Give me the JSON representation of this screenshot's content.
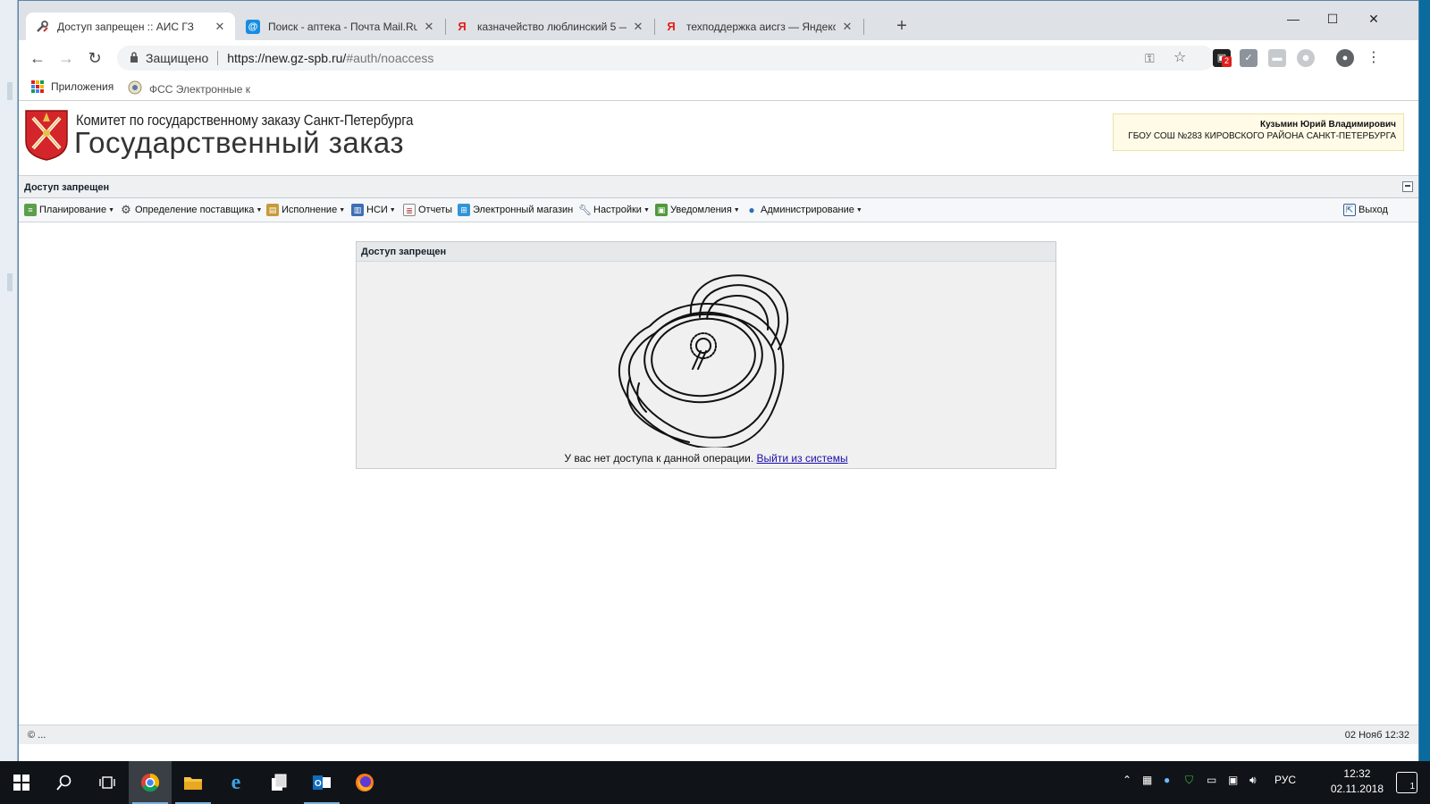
{
  "browser": {
    "tabs": [
      {
        "title": "Доступ запрещен :: АИС ГЗ",
        "active": true,
        "favicon": "tools-icon"
      },
      {
        "title": "Поиск - аптека - Почта Mail.Ru",
        "active": false,
        "favicon": "mail-at-icon"
      },
      {
        "title": "казначейство люблинский 5 —",
        "active": false,
        "favicon": "yandex-icon"
      },
      {
        "title": "техподдержка аисгз — Яндекс",
        "active": false,
        "favicon": "yandex-icon"
      }
    ],
    "new_tab": "+",
    "window_controls": {
      "minimize": "—",
      "maximize": "☐",
      "close": "✕"
    },
    "address": {
      "secure_label": "Защищено",
      "url_host": "https://new.gz-spb.ru/",
      "url_path": "#auth/noaccess"
    },
    "extensions": {
      "badge": "2"
    },
    "bookmarks": [
      {
        "label": "Приложения",
        "icon": "apps-grid-icon"
      },
      {
        "label": "ФСС Электронные к",
        "icon": "fss-emblem-icon"
      }
    ]
  },
  "site": {
    "org_name": "Комитет по государственному заказу Санкт-Петербурга",
    "title": "Государственный заказ",
    "user": {
      "name": "Кузьмин Юрий Владимирович",
      "org": "ГБОУ СОШ №283 КИРОВСКОГО РАЙОНА САНКТ-ПЕТЕРБУРГА"
    },
    "panel_title": "Доступ запрещен",
    "menu": [
      {
        "label": "Планирование",
        "dropdown": true,
        "icon": "planning-icon"
      },
      {
        "label": "Определение поставщика",
        "dropdown": true,
        "icon": "gear-icon"
      },
      {
        "label": "Исполнение",
        "dropdown": true,
        "icon": "execution-icon"
      },
      {
        "label": "НСИ",
        "dropdown": true,
        "icon": "book-icon"
      },
      {
        "label": "Отчеты",
        "dropdown": false,
        "icon": "report-icon"
      },
      {
        "label": "Электронный магазин",
        "dropdown": false,
        "icon": "cart-icon"
      },
      {
        "label": "Настройки",
        "dropdown": true,
        "icon": "wrench-icon"
      },
      {
        "label": "Уведомления",
        "dropdown": true,
        "icon": "notification-icon"
      },
      {
        "label": "Администрирование",
        "dropdown": true,
        "icon": "user-icon"
      }
    ],
    "logout_label": "Выход",
    "dialog": {
      "title": "Доступ запрещен",
      "message": "У вас нет доступа к данной операции.",
      "link": "Выйти из системы"
    },
    "status": {
      "left": "© ...",
      "right": "02 Нояб 12:32"
    }
  },
  "taskbar": {
    "lang": "РУС",
    "time": "12:32",
    "date": "02.11.2018",
    "notifications": "1"
  },
  "colors": {
    "accent_link": "#1a0dab",
    "emblem_red": "#d4262a",
    "taskbar": "#101418"
  }
}
